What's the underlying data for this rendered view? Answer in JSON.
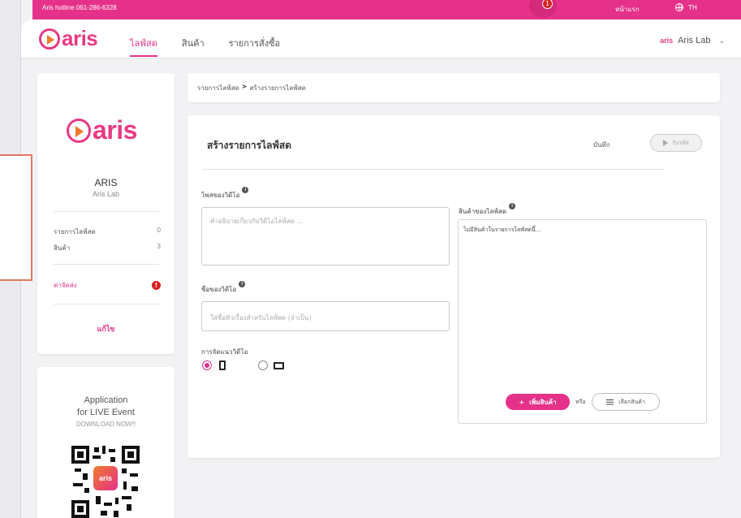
{
  "topbar": {
    "hotline": "Aris hotline 061-286-6328",
    "home_label": "หน้าแรก",
    "lang_label": "TH",
    "notify_count": "1"
  },
  "brand": {
    "logo_text": "aris",
    "mini_logo_text": "aris"
  },
  "nav": {
    "items": [
      {
        "label": "ไลฟ์สด",
        "active": true
      },
      {
        "label": "สินค้า",
        "active": false
      },
      {
        "label": "รายการสั่งซื้อ",
        "active": false
      }
    ],
    "user_name": "Aris Lab"
  },
  "sidebar": {
    "name": "ARIS",
    "sub": "Aris Lab",
    "stats": [
      {
        "label": "รายการไลฟ์สด",
        "value": "0"
      },
      {
        "label": "สินค้า",
        "value": "3"
      }
    ],
    "shipping_label": "ค่าจัดส่ง",
    "shipping_alert": "!",
    "edit_label": "แก้ไข"
  },
  "app_promo": {
    "line1": "Application",
    "line2": "for LIVE Event",
    "download": "DOWNLOAD NOW!!",
    "qr_label": "aris"
  },
  "breadcrumb": {
    "parent": "รายการไลฟ์สด",
    "separator": ">",
    "current": "สร้างรายการไลฟ์สด"
  },
  "form": {
    "title": "สร้างรายการไลฟ์สด",
    "save_label": "บันทึก",
    "receive_label": "รับรหัส",
    "description_label": "โพสของวิดีโอ",
    "description_placeholder": "คำอธิบายเกี่ยวกับวิดีโอไลฟ์สด ...",
    "video_name_label": "ชื่อของวิดีโอ",
    "video_name_placeholder": "ใส่ชื่อหัวเรื่องสำหรับไลฟ์สด (จำเป็น)",
    "orientation_label": "การจัดแนววิดีโอ",
    "orientation_selected": "portrait",
    "products_label": "สินค้าของไลฟ์สด",
    "products_empty": "ไม่มีสินค้าในรายการไลฟ์สดนี้...",
    "add_product_label": "เพิ่มสินค้า",
    "or_label": "หรือ",
    "pick_product_label": "เลือกสินค้า",
    "info_glyph": "i"
  },
  "colors": {
    "accent": "#e5318a",
    "alert": "#d92020",
    "logo_orange": "#f07a2c"
  }
}
